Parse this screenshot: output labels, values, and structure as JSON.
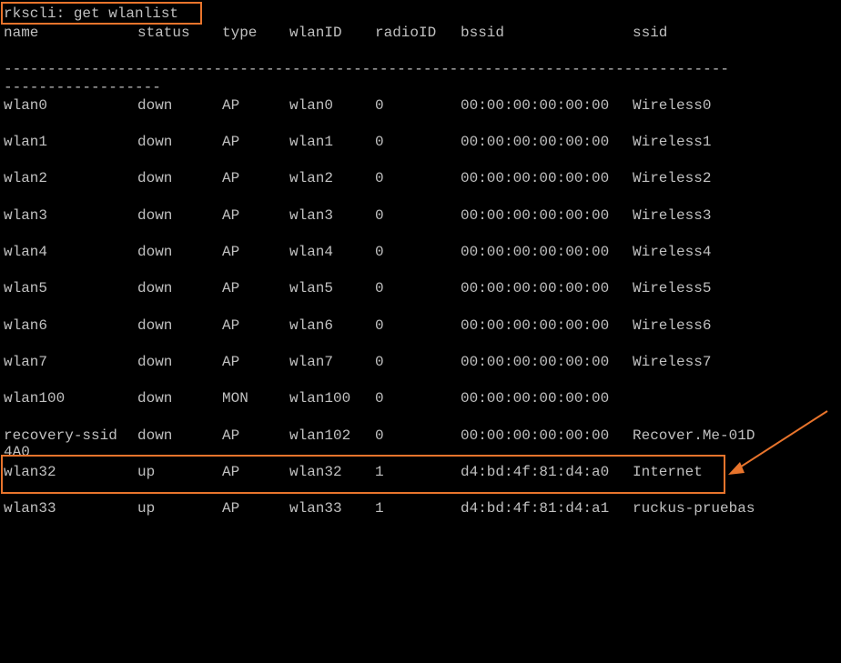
{
  "terminal": {
    "command": "rkscli: get wlanlist",
    "headers": {
      "name": "name",
      "status": "status",
      "type": "type",
      "wlanid": "wlanID",
      "radio": "radioID",
      "bssid": "bssid",
      "ssid": "ssid"
    },
    "separator1": "-----------------------------------------------------------------------------------",
    "separator2": "------------------",
    "rows": [
      {
        "name": "wlan0",
        "status": "down",
        "type": "AP",
        "wlanid": "wlan0",
        "radio": "0",
        "bssid": "00:00:00:00:00:00",
        "ssid": "Wireless0"
      },
      {
        "name": "wlan1",
        "status": "down",
        "type": "AP",
        "wlanid": "wlan1",
        "radio": "0",
        "bssid": "00:00:00:00:00:00",
        "ssid": "Wireless1"
      },
      {
        "name": "wlan2",
        "status": "down",
        "type": "AP",
        "wlanid": "wlan2",
        "radio": "0",
        "bssid": "00:00:00:00:00:00",
        "ssid": "Wireless2"
      },
      {
        "name": "wlan3",
        "status": "down",
        "type": "AP",
        "wlanid": "wlan3",
        "radio": "0",
        "bssid": "00:00:00:00:00:00",
        "ssid": "Wireless3"
      },
      {
        "name": "wlan4",
        "status": "down",
        "type": "AP",
        "wlanid": "wlan4",
        "radio": "0",
        "bssid": "00:00:00:00:00:00",
        "ssid": "Wireless4"
      },
      {
        "name": "wlan5",
        "status": "down",
        "type": "AP",
        "wlanid": "wlan5",
        "radio": "0",
        "bssid": "00:00:00:00:00:00",
        "ssid": "Wireless5"
      },
      {
        "name": "wlan6",
        "status": "down",
        "type": "AP",
        "wlanid": "wlan6",
        "radio": "0",
        "bssid": "00:00:00:00:00:00",
        "ssid": "Wireless6"
      },
      {
        "name": "wlan7",
        "status": "down",
        "type": "AP",
        "wlanid": "wlan7",
        "radio": "0",
        "bssid": "00:00:00:00:00:00",
        "ssid": "Wireless7"
      },
      {
        "name": "wlan100",
        "status": "down",
        "type": "MON",
        "wlanid": "wlan100",
        "radio": "0",
        "bssid": "00:00:00:00:00:00",
        "ssid": ""
      },
      {
        "name": "recovery-ssid",
        "status": "down",
        "type": "AP",
        "wlanid": "wlan102",
        "radio": "0",
        "bssid": "00:00:00:00:00:00",
        "ssid": "Recover.Me-01D"
      },
      {
        "name": "wlan32",
        "status": "up",
        "type": "AP",
        "wlanid": "wlan32",
        "radio": "1",
        "bssid": "d4:bd:4f:81:d4:a0",
        "ssid": "Internet"
      },
      {
        "name": "wlan33",
        "status": "up",
        "type": "AP",
        "wlanid": "wlan33",
        "radio": "1",
        "bssid": "d4:bd:4f:81:d4:a1",
        "ssid": "ruckus-pruebas"
      }
    ],
    "wrap_text": "4A0"
  },
  "colors": {
    "background": "#000000",
    "text": "#c0c0c0",
    "highlight": "#e8742c"
  }
}
